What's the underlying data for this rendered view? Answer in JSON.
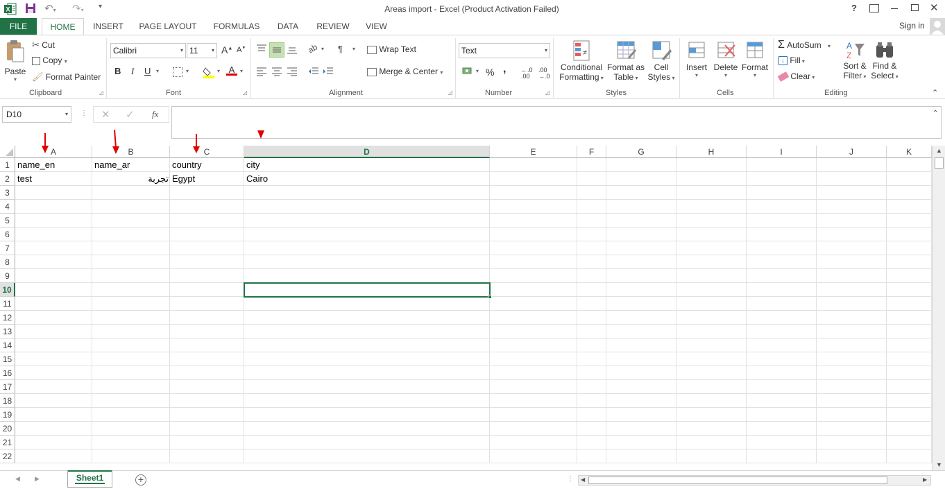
{
  "window": {
    "title": "Areas import - Excel (Product Activation Failed)",
    "help": "?",
    "sign_in": "Sign in"
  },
  "ribbon_tabs": [
    {
      "label": "FILE"
    },
    {
      "label": "HOME"
    },
    {
      "label": "INSERT"
    },
    {
      "label": "PAGE LAYOUT"
    },
    {
      "label": "FORMULAS"
    },
    {
      "label": "DATA"
    },
    {
      "label": "REVIEW"
    },
    {
      "label": "VIEW"
    }
  ],
  "clipboard": {
    "paste": "Paste",
    "cut": "Cut",
    "copy": "Copy",
    "format_painter": "Format Painter",
    "label": "Clipboard"
  },
  "font": {
    "name": "Calibri",
    "size": "11",
    "grow": "A",
    "shrink": "A",
    "bold": "B",
    "italic": "I",
    "underline": "U",
    "label": "Font"
  },
  "alignment": {
    "wrap_text": "Wrap Text",
    "merge_center": "Merge & Center",
    "label": "Alignment"
  },
  "number": {
    "format": "Text",
    "percent": "%",
    "comma": ",",
    "label": "Number"
  },
  "styles": {
    "conditional_1": "Conditional",
    "conditional_2": "Formatting",
    "format_table_1": "Format as",
    "format_table_2": "Table",
    "cell_styles_1": "Cell",
    "cell_styles_2": "Styles",
    "label": "Styles"
  },
  "cells": {
    "insert": "Insert",
    "delete": "Delete",
    "format": "Format",
    "label": "Cells"
  },
  "editing": {
    "autosum": "AutoSum",
    "fill": "Fill",
    "clear": "Clear",
    "sort_1": "Sort &",
    "sort_2": "Filter",
    "find_1": "Find &",
    "find_2": "Select",
    "label": "Editing"
  },
  "formula_bar": {
    "name_box": "D10",
    "fx": "fx",
    "content": ""
  },
  "columns": [
    "A",
    "B",
    "C",
    "D",
    "E",
    "F",
    "G",
    "H",
    "I",
    "J",
    "K"
  ],
  "rows": [
    "1",
    "2",
    "3",
    "4",
    "5",
    "6",
    "7",
    "8",
    "9",
    "10",
    "11",
    "12",
    "13",
    "14",
    "15",
    "16",
    "17",
    "18",
    "19",
    "20",
    "21",
    "22"
  ],
  "cells_data": {
    "A1": "name_en",
    "B1": "name_ar",
    "C1": "country",
    "D1": "city",
    "A2": "test",
    "B2": "تجربة",
    "C2": "Egypt",
    "D2": "Cairo"
  },
  "active_cell": "D10",
  "sheet_tabs": [
    {
      "label": "Sheet1"
    }
  ],
  "colors": {
    "excel_green": "#217346",
    "annotation_red": "#e00000",
    "ribbon_text": "#444444"
  }
}
